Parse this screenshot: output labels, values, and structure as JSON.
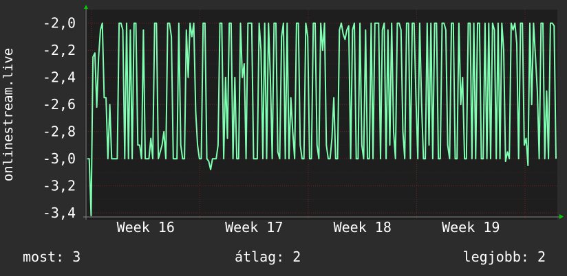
{
  "chart_data": {
    "type": "line",
    "ylabel": "onlinestream.live",
    "ylim": [
      -3.45,
      -1.9
    ],
    "yticks": [
      {
        "value": -2.0,
        "label": "-2,0"
      },
      {
        "value": -2.2,
        "label": "-2,2"
      },
      {
        "value": -2.4,
        "label": "-2,4"
      },
      {
        "value": -2.6,
        "label": "-2,6"
      },
      {
        "value": -2.8,
        "label": "-2,8"
      },
      {
        "value": -3.0,
        "label": "-3,0"
      },
      {
        "value": -3.2,
        "label": "-3,2"
      },
      {
        "value": -3.4,
        "label": "-3,4"
      }
    ],
    "xticks": [
      "Week 16",
      "Week 17",
      "Week 18",
      "Week 19"
    ],
    "grid": true,
    "colors": {
      "background": "#2c2c2c",
      "plot": "#1e1e1e",
      "line": "#7fffb2",
      "grid": "#5a1c1c",
      "text": "#ffffff",
      "arrow": "#00cc00"
    },
    "series": [
      {
        "values": [
          -3.0,
          -3.0,
          -3.42,
          -2.25,
          -2.22,
          -2.62,
          -2.25,
          -2.05,
          -2.0,
          -2.55,
          -2.55,
          -3.0,
          -2.6,
          -3.0,
          -3.0,
          -3.0,
          -3.0,
          -2.0,
          -2.0,
          -2.05,
          -3.0,
          -2.0,
          -3.0,
          -2.05,
          -3.0,
          -2.0,
          -2.0,
          -2.9,
          -2.9,
          -3.0,
          -2.05,
          -3.0,
          -3.0,
          -3.0,
          -2.85,
          -3.0,
          -2.0,
          -2.0,
          -3.0,
          -2.95,
          -2.9,
          -2.8,
          -3.0,
          -2.0,
          -2.0,
          -2.1,
          -3.0,
          -3.0,
          -3.0,
          -2.0,
          -2.9,
          -3.0,
          -3.0,
          -2.05,
          -2.4,
          -2.0,
          -2.1,
          -2.0,
          -2.65,
          -2.9,
          -3.0,
          -3.0,
          -2.0,
          -2.0,
          -3.0,
          -3.02,
          -3.08,
          -3.0,
          -3.0,
          -3.0,
          -2.9,
          -2.0,
          -2.0,
          -3.0,
          -2.4,
          -2.85,
          -2.0,
          -2.0,
          -3.0,
          -2.4,
          -3.0,
          -3.0,
          -2.0,
          -2.4,
          -2.3,
          -3.0,
          -2.0,
          -2.0,
          -2.0,
          -3.0,
          -3.0,
          -3.0,
          -2.0,
          -2.2,
          -3.0,
          -2.0,
          -3.0,
          -2.0,
          -2.4,
          -3.0,
          -2.0,
          -2.0,
          -2.95,
          -3.0,
          -2.1,
          -2.0,
          -3.0,
          -2.0,
          -3.0,
          -2.55,
          -2.8,
          -3.0,
          -2.0,
          -2.0,
          -2.9,
          -3.0,
          -3.0,
          -2.0,
          -2.1,
          -3.0,
          -3.0,
          -2.0,
          -2.0,
          -2.9,
          -3.0,
          -2.0,
          -2.2,
          -2.0,
          -2.9,
          -3.0,
          -3.0,
          -2.85,
          -2.55,
          -3.0,
          -3.0,
          -2.05,
          -2.0,
          -2.08,
          -2.12,
          -2.05,
          -2.02,
          -3.0,
          -2.05,
          -2.0,
          -3.0,
          -3.0,
          -2.0,
          -2.9,
          -3.0,
          -2.05,
          -3.0,
          -3.0,
          -2.0,
          -3.0,
          -2.0,
          -2.0,
          -2.0,
          -3.0,
          -2.05,
          -2.0,
          -3.0,
          -2.05,
          -2.9,
          -2.0,
          -2.8,
          -3.0,
          -2.0,
          -2.0,
          -2.05,
          -2.8,
          -3.0,
          -2.0,
          -2.0,
          -3.0,
          -2.0,
          -2.0,
          -2.55,
          -3.0,
          -2.0,
          -2.6,
          -3.0,
          -3.0,
          -2.0,
          -2.9,
          -2.0,
          -3.0,
          -2.0,
          -2.0,
          -3.0,
          -3.0,
          -2.0,
          -2.0,
          -2.05,
          -2.9,
          -3.0,
          -2.0,
          -2.0,
          -3.0,
          -3.0,
          -2.0,
          -2.6,
          -2.4,
          -3.0,
          -3.0,
          -2.0,
          -2.0,
          -3.0,
          -2.0,
          -3.0,
          -2.0,
          -2.0,
          -3.0,
          -3.0,
          -2.0,
          -3.0,
          -2.0,
          -3.0,
          -2.0,
          -2.05,
          -3.0,
          -2.0,
          -3.0,
          -2.0,
          -2.2,
          -3.02,
          -2.95,
          -3.0,
          -2.0,
          -2.05,
          -2.0,
          -2.15,
          -3.0,
          -2.0,
          -2.0,
          -2.9,
          -2.85,
          -3.05,
          -2.0,
          -2.6,
          -2.0,
          -2.25,
          -2.5,
          -3.0,
          -2.0,
          -2.0,
          -3.0,
          -2.5,
          -3.0,
          -2.0,
          -2.0,
          -2.02,
          -3.0
        ]
      }
    ]
  },
  "footer": {
    "now": "most: 3",
    "avg": "átlag: 2",
    "max": "legjobb: 2"
  }
}
